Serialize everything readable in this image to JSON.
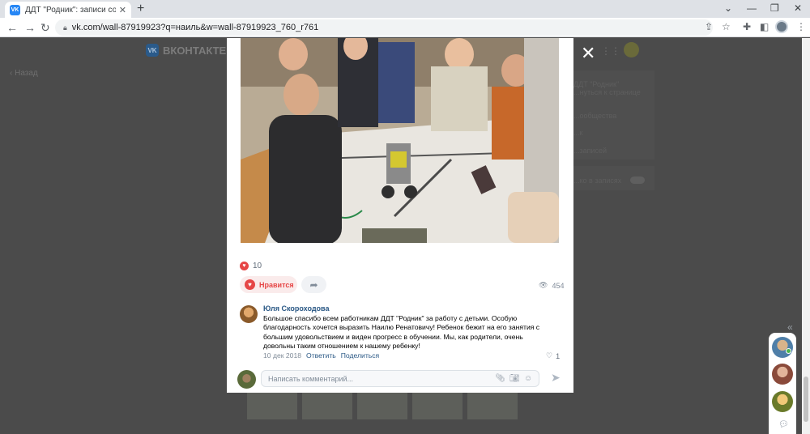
{
  "browser": {
    "tab_title": "ДДТ \"Родник\": записи сообщест",
    "favicon_text": "VK",
    "url": "vk.com/wall-87919923?q=наиль&w=wall-87919923_760_r761"
  },
  "page": {
    "logo_text": "ВКОНТАКТЕ",
    "logo_mark": "VK",
    "back_label": "Назад",
    "side_texts": [
      "ДДТ \"Родник\"",
      "...нуться к странице",
      "...ообщества",
      "...к",
      "...записей",
      "...ко в записях"
    ]
  },
  "post": {
    "likes_count": "10",
    "like_button_label": "Нравится",
    "views": "454"
  },
  "comment": {
    "author": "Юля Скороходова",
    "text": "Большое спасибо всем работникам ДДТ \"Родник\" за работу с детьми. Особую благодарность хочется выразить Наилю Ренатовичу! Ребенок бежит на его занятия с большим удовольствием и виден прогресс в обучении. Мы, как родители, очень довольны таким отношением к нашему ребенку!",
    "date": "10 дек 2018",
    "reply_label": "Ответить",
    "share_label": "Поделиться",
    "likes": "1"
  },
  "comment_input": {
    "placeholder": "Написать комментарий..."
  },
  "colors": {
    "vk_blue": "#2a5885",
    "like_red": "#e64646",
    "overlay": "#4b4b4b"
  }
}
